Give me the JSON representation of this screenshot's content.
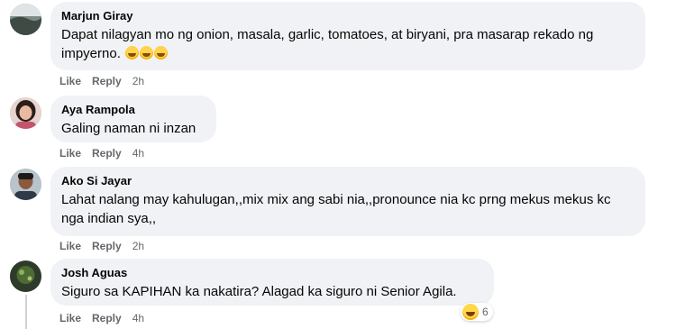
{
  "comments": [
    {
      "author": "Marjun Giray",
      "text": "Dapat nilagyan mo ng onion, masala, garlic, tomatoes, at biryani, pra masarap rekado ng impyerno.",
      "emoji": [
        "rofl",
        "rofl",
        "rofl"
      ],
      "like_label": "Like",
      "reply_label": "Reply",
      "time": "2h"
    },
    {
      "author": "Aya Rampola",
      "text": "Galing naman ni inzan",
      "like_label": "Like",
      "reply_label": "Reply",
      "time": "4h"
    },
    {
      "author": "Ako Si Jayar",
      "text": "Lahat nalang may kahulugan,,mix mix ang sabi nia,,pronounce nia kc prng mekus mekus kc nga indian sya,,",
      "like_label": "Like",
      "reply_label": "Reply",
      "time": "2h"
    },
    {
      "author": "Josh Aguas",
      "text": "Siguro sa KAPIHAN ka nakatira? Alagad ka siguro ni Senior Agila.",
      "like_label": "Like",
      "reply_label": "Reply",
      "time": "4h",
      "reaction": {
        "icon": "haha-icon",
        "count": "6"
      }
    }
  ],
  "colors": {
    "bubble_bg": "#f0f2f5",
    "meta_text": "#65676b",
    "text": "#050505"
  }
}
